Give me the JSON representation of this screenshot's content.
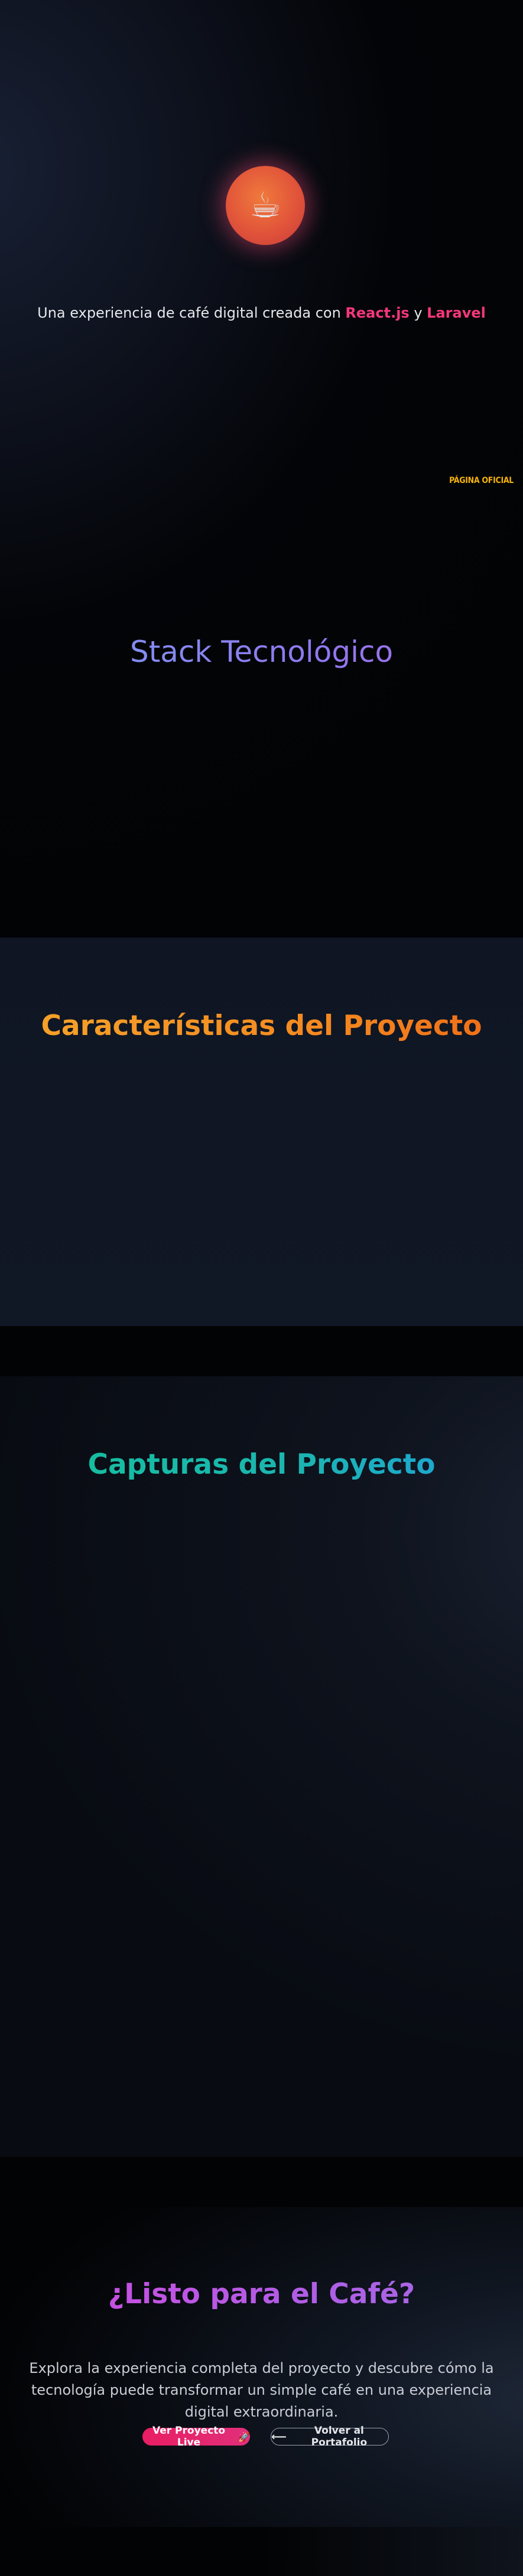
{
  "hero": {
    "logo_icon": "coffee-cup-icon",
    "logo_glyph": "☕",
    "subtitle_prefix": "Una experiencia de café digital creada con ",
    "subtitle_tech1": "React.js",
    "subtitle_conjunction": " y ",
    "subtitle_tech2": "Laravel",
    "official_tag": "PÁGINA OFICIAL"
  },
  "stack": {
    "title": "Stack Tecnológico"
  },
  "features": {
    "title": "Características del Proyecto"
  },
  "screenshots": {
    "title": "Capturas del Proyecto"
  },
  "cta": {
    "title": "¿Listo para el Café?",
    "text": "Explora la experiencia completa del proyecto y descubre cómo la tecnología puede transformar un simple café en una experiencia digital extraordinaria.",
    "live_button_label": "Ver Proyecto Live",
    "live_button_icon": "rocket-icon",
    "live_button_glyph": "🚀",
    "back_button_label": "Volver al Portafolio",
    "back_button_icon": "arrow-left-icon",
    "back_button_glyph": "⟵"
  },
  "colors": {
    "accent_pink": "#e91e63",
    "accent_orange": "#f48a20",
    "accent_teal": "#1bb6b0",
    "accent_purple": "#8f78ee",
    "official_tag": "#f5b30b"
  }
}
